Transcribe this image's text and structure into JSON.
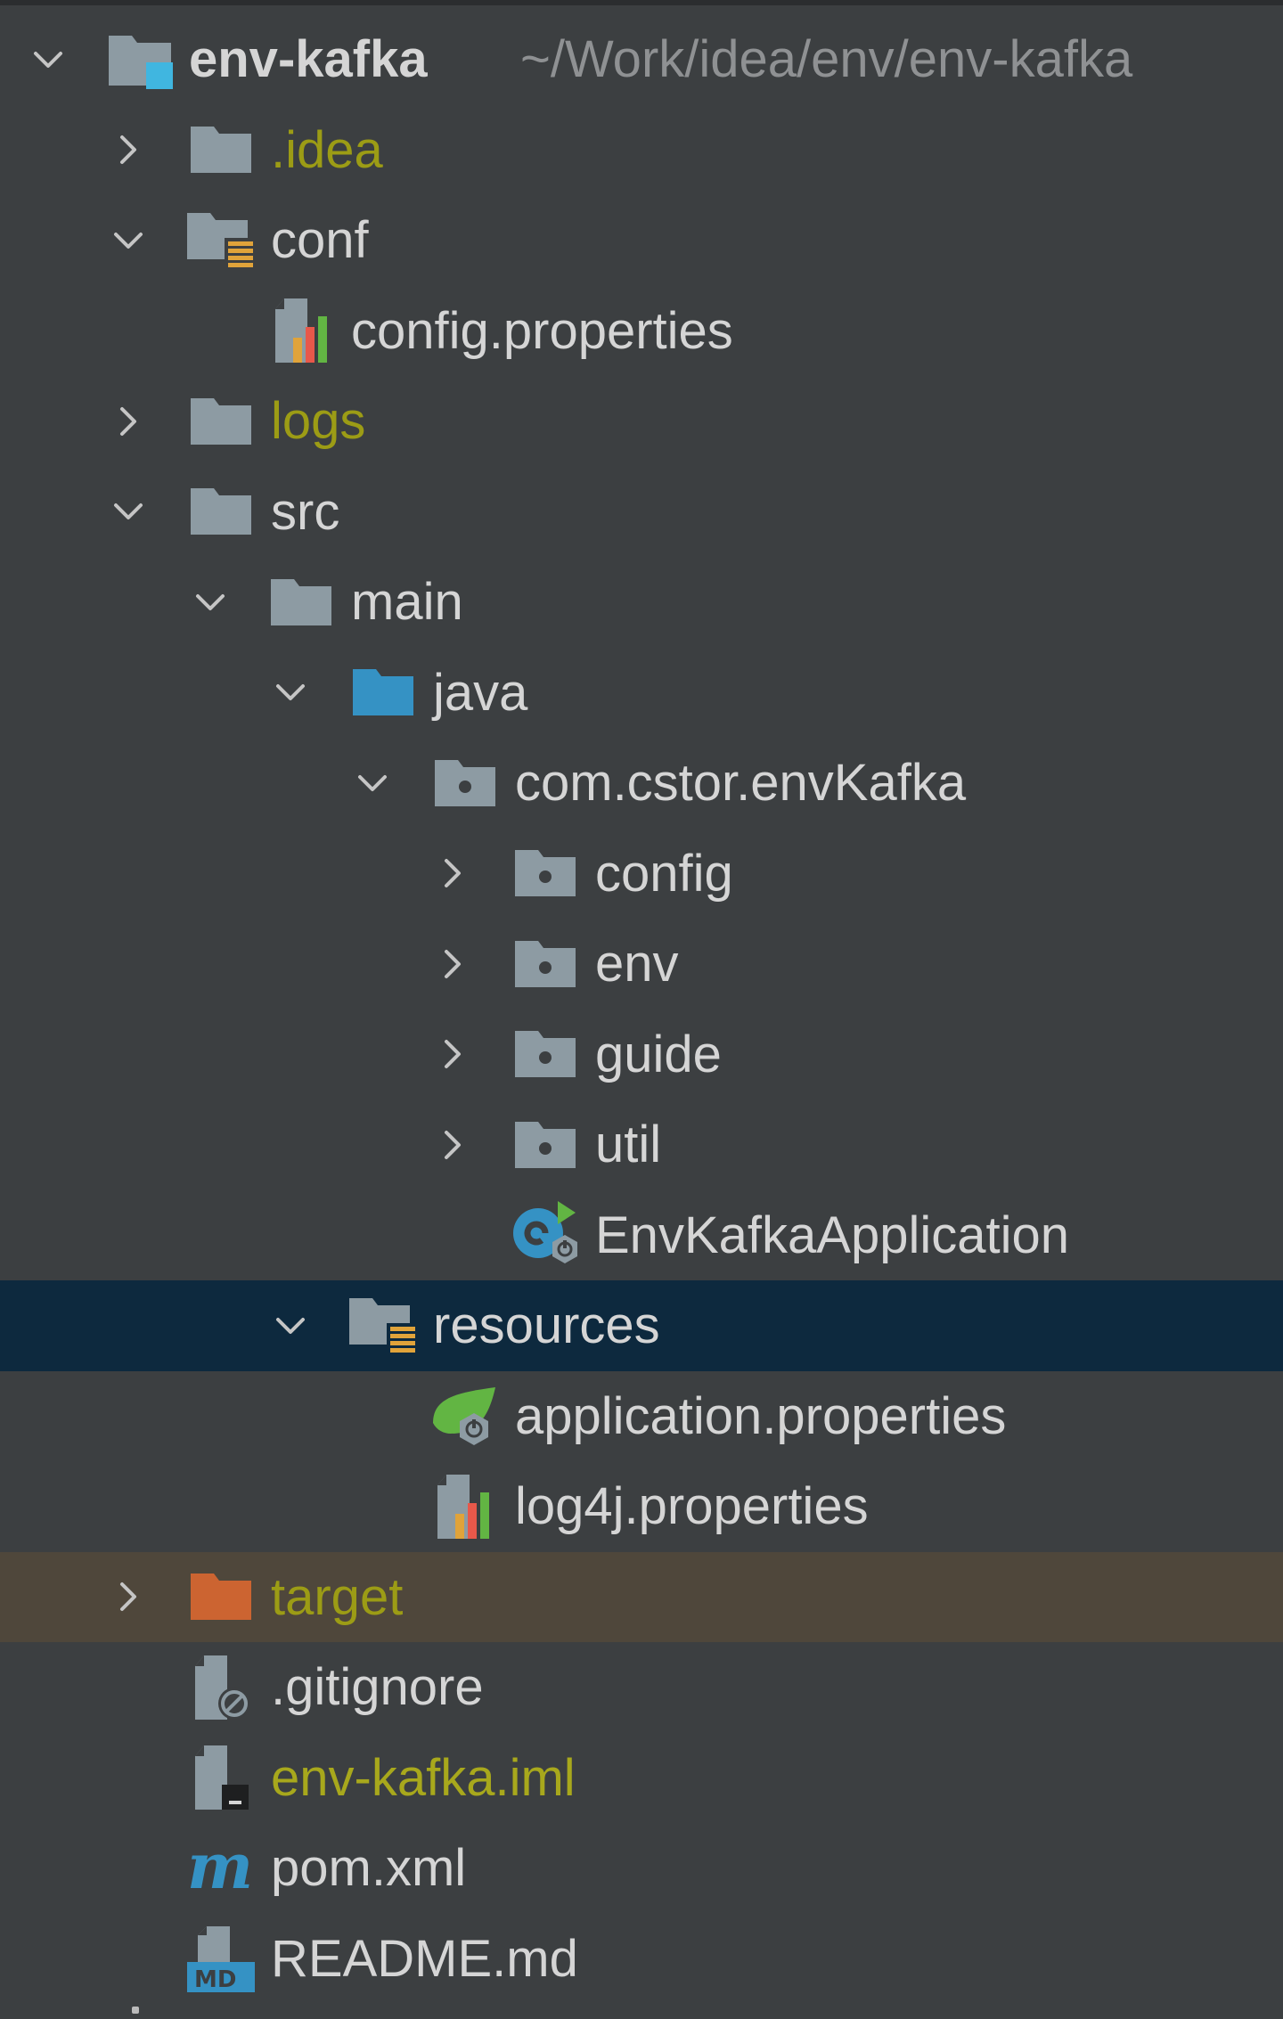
{
  "project": {
    "name": "env-kafka",
    "path": "~/Work/idea/env/env-kafka"
  },
  "tree": {
    "idea": ".idea",
    "conf": "conf",
    "config_properties": "config.properties",
    "logs": "logs",
    "src": "src",
    "main": "main",
    "java": "java",
    "package": "com.cstor.envKafka",
    "pkg_config": "config",
    "pkg_env": "env",
    "pkg_guide": "guide",
    "pkg_util": "util",
    "app_class": "EnvKafkaApplication",
    "resources": "resources",
    "application_properties": "application.properties",
    "log4j_properties": "log4j.properties",
    "target": "target",
    "gitignore": ".gitignore",
    "iml": "env-kafka.iml",
    "pom": "pom.xml",
    "readme": "README.md"
  },
  "colors": {
    "background": "#3c3f41",
    "selected_row": "#0d293e",
    "excluded_row": "#4f473b",
    "text": "#d5d5d5",
    "ignored_text": "#9c9c15",
    "folder": "#8d9ba3",
    "source_folder": "#3592c4",
    "excluded_folder": "#cc6431"
  },
  "icons": {
    "expand": "chevron-down-icon",
    "collapse": "chevron-right-icon",
    "folder": "folder-icon",
    "module": "module-folder-icon",
    "resources": "resources-folder-icon",
    "package": "package-icon",
    "properties": "properties-file-icon",
    "spring": "spring-boot-icon",
    "gitignore": "ignore-file-icon",
    "iml": "iml-file-icon",
    "maven": "maven-icon",
    "markdown": "markdown-icon"
  }
}
